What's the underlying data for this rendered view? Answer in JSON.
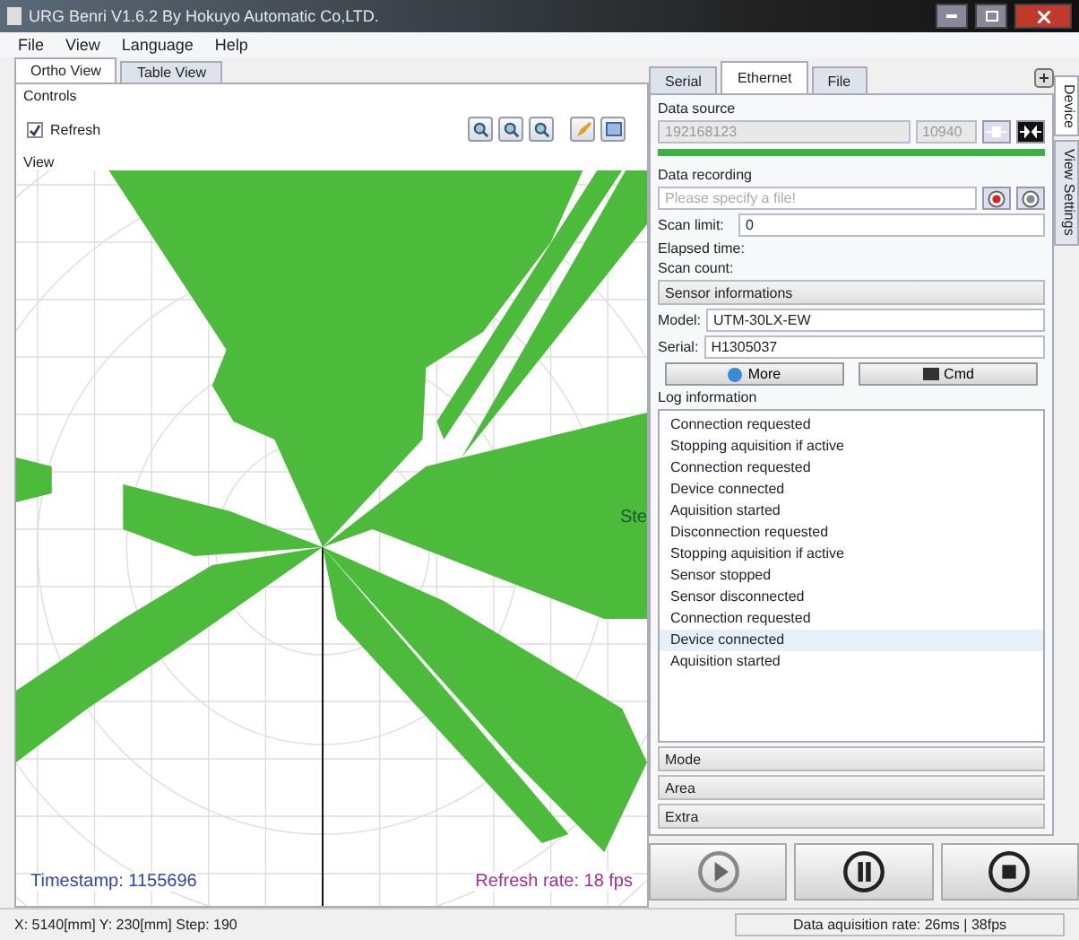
{
  "window": {
    "title": "URG Benri V1.6.2 By Hokuyo Automatic Co,LTD."
  },
  "menu": [
    "File",
    "View",
    "Language",
    "Help"
  ],
  "view_tabs": [
    {
      "label": "Ortho View",
      "selected": true
    },
    {
      "label": "Table View",
      "selected": false
    }
  ],
  "controls": {
    "title": "Controls",
    "refresh": {
      "label": "Refresh",
      "checked": true
    }
  },
  "view": {
    "title": "View",
    "overlay_text": "Ste",
    "timestamp": "Timestamp: 1155696",
    "refresh_rate": "Refresh rate: 18 fps"
  },
  "device_tabs": [
    {
      "label": "Serial",
      "selected": false
    },
    {
      "label": "Ethernet",
      "selected": true
    },
    {
      "label": "File",
      "selected": false
    }
  ],
  "side_tabs": [
    {
      "label": "Device",
      "selected": true
    },
    {
      "label": "View Settings",
      "selected": false
    }
  ],
  "data_source": {
    "title": "Data source",
    "address": "192168123",
    "port": "10940",
    "level": 1
  },
  "data_recording": {
    "title": "Data recording",
    "placeholder": "Please specify a file!",
    "scan_limit_label": "Scan limit:",
    "scan_limit": "0",
    "elapsed_label": "Elapsed time:",
    "scan_count_label": "Scan count:"
  },
  "sensor": {
    "title": "Sensor informations",
    "model_label": "Model:",
    "model": "UTM-30LX-EW",
    "serial_label": "Serial:",
    "serial": "H1305037",
    "buttons": [
      "More",
      "Cmd"
    ]
  },
  "log": {
    "title": "Log information",
    "entries": [
      {
        "text": "Connection requested",
        "selected": false
      },
      {
        "text": "Stopping aquisition if active",
        "selected": false
      },
      {
        "text": "Connection requested",
        "selected": false
      },
      {
        "text": "Device connected",
        "selected": false
      },
      {
        "text": "Aquisition started",
        "selected": false
      },
      {
        "text": "Disconnection requested",
        "selected": false
      },
      {
        "text": "Stopping aquisition if active",
        "selected": false
      },
      {
        "text": "Sensor stopped",
        "selected": false
      },
      {
        "text": "Sensor disconnected",
        "selected": false
      },
      {
        "text": "Connection requested",
        "selected": false
      },
      {
        "text": "Device connected",
        "selected": true
      },
      {
        "text": "Aquisition started",
        "selected": false
      }
    ]
  },
  "sections": [
    "Mode",
    "Area",
    "Extra"
  ],
  "status_bar": {
    "position": "X: 5140[mm] Y: 230[mm] Step: 190",
    "rate": "Data aquisition rate: 26ms | 38fps"
  }
}
